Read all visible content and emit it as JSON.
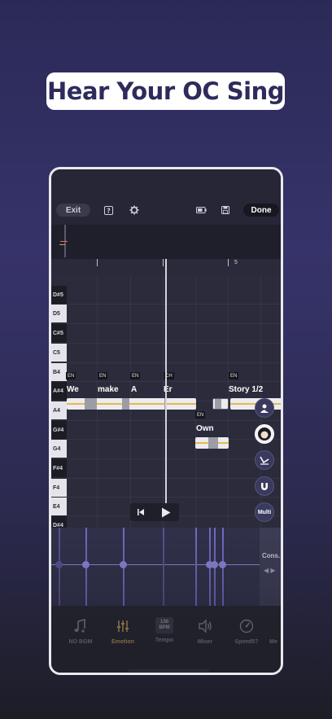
{
  "headline": "Hear Your OC Sing",
  "toolbar": {
    "exit_label": "Exit",
    "done_label": "Done",
    "icons": [
      "help-icon",
      "gear-icon",
      "battery-icon",
      "save-icon"
    ]
  },
  "ruler": {
    "marker_label": "5"
  },
  "piano_keys": [
    {
      "label": "D#5",
      "color": "black"
    },
    {
      "label": "D5",
      "color": "white"
    },
    {
      "label": "C#5",
      "color": "black"
    },
    {
      "label": "C5",
      "color": "white"
    },
    {
      "label": "B4",
      "color": "white"
    },
    {
      "label": "A#4",
      "color": "black"
    },
    {
      "label": "A4",
      "color": "white"
    },
    {
      "label": "G#4",
      "color": "black"
    },
    {
      "label": "G4",
      "color": "white"
    },
    {
      "label": "F#4",
      "color": "black"
    },
    {
      "label": "F4",
      "color": "white"
    },
    {
      "label": "E4",
      "color": "white"
    },
    {
      "label": "D#4",
      "color": "black"
    }
  ],
  "notes": [
    {
      "lang": "EN",
      "lyric": "We"
    },
    {
      "lang": "EN",
      "lyric": "make"
    },
    {
      "lang": "EN",
      "lyric": "A"
    },
    {
      "lang": "CH",
      "lyric": "Er"
    },
    {
      "lang": "EN",
      "lyric": "Own"
    },
    {
      "lang": "EN",
      "lyric": "Story 1/2"
    }
  ],
  "side_tools": {
    "multi_label": "Multi"
  },
  "automation": {
    "panel_label": "Cons."
  },
  "bottom_bar": [
    {
      "label": "NO BGM",
      "icon": "music-note-plus-icon"
    },
    {
      "label": "Emotion",
      "icon": "sliders-icon"
    },
    {
      "label": "Tempo",
      "icon": "bpm-icon",
      "badge_value": "130",
      "badge_unit": "BPM"
    },
    {
      "label": "Mixer",
      "icon": "speaker-icon"
    },
    {
      "label": "Speed5?",
      "icon": "gauge-icon"
    },
    {
      "label": "Me",
      "icon": "more-icon"
    }
  ],
  "colors": {
    "accent": "#e6b94a",
    "note": "#ebebf0",
    "automation": "#8884d8",
    "headline_text": "#2e2b5c"
  }
}
